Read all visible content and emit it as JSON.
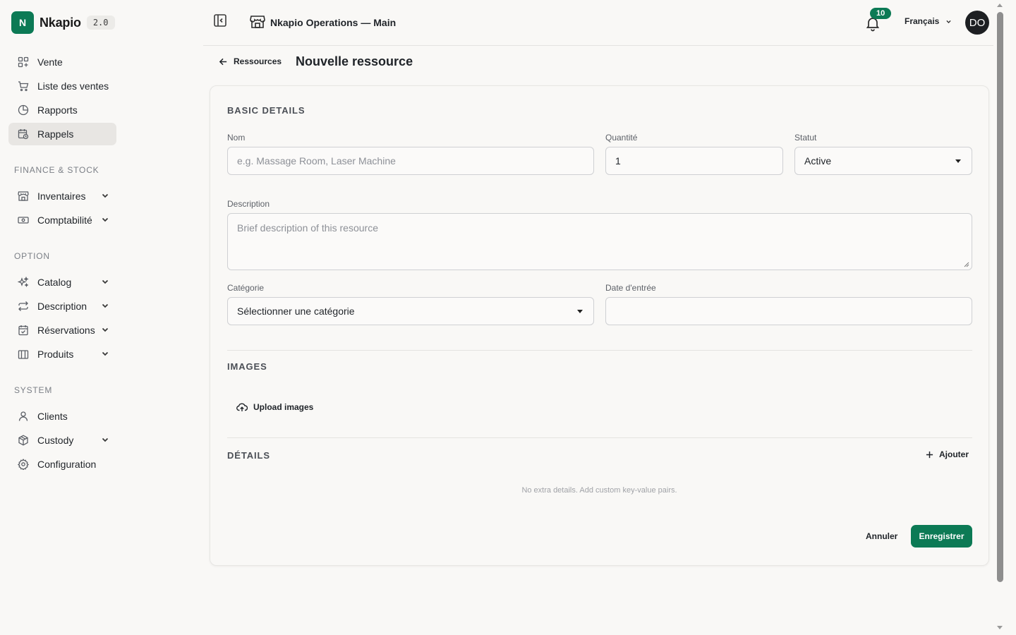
{
  "brand": {
    "logo_letter": "N",
    "name": "Nkapio",
    "version": "2.0"
  },
  "sidebar": {
    "main_items": [
      {
        "label": "Vente",
        "icon": "layout-grid-plus-icon"
      },
      {
        "label": "Liste des ventes",
        "icon": "shopping-cart-icon"
      },
      {
        "label": "Rapports",
        "icon": "pie-chart-icon"
      },
      {
        "label": "Rappels",
        "icon": "calendar-clock-icon",
        "active": true
      }
    ],
    "sections": [
      {
        "title": "FINANCE & STOCK",
        "items": [
          {
            "label": "Inventaires",
            "icon": "store-icon",
            "expandable": true
          },
          {
            "label": "Comptabilité",
            "icon": "banknote-icon",
            "expandable": true
          }
        ]
      },
      {
        "title": "OPTION",
        "items": [
          {
            "label": "Catalog",
            "icon": "sparkles-icon",
            "expandable": true
          },
          {
            "label": "Description",
            "icon": "repeat-icon",
            "expandable": true
          },
          {
            "label": "Réservations",
            "icon": "calendar-check-icon",
            "expandable": true
          },
          {
            "label": "Produits",
            "icon": "package-icon",
            "expandable": true
          }
        ]
      },
      {
        "title": "SYSTEM",
        "items": [
          {
            "label": "Clients",
            "icon": "user-icon",
            "expandable": false
          },
          {
            "label": "Custody",
            "icon": "box-icon",
            "expandable": true
          },
          {
            "label": "Configuration",
            "icon": "gear-icon",
            "expandable": false
          }
        ]
      }
    ]
  },
  "topbar": {
    "store_name": "Nkapio Operations — Main",
    "notifications_count": "10",
    "language": "Français",
    "avatar_initials": "DO"
  },
  "page": {
    "back_label": "Ressources",
    "title": "Nouvelle ressource"
  },
  "form": {
    "basic_details_title": "BASIC DETAILS",
    "name_label": "Nom",
    "name_placeholder": "e.g. Massage Room, Laser Machine",
    "quantity_label": "Quantité",
    "quantity_value": "1",
    "status_label": "Statut",
    "status_value": "Active",
    "description_label": "Description",
    "description_placeholder": "Brief description of this resource",
    "category_label": "Catégorie",
    "category_value": "Sélectionner une catégorie",
    "entry_date_label": "Date d'entrée",
    "entry_date_value": "",
    "images_title": "IMAGES",
    "upload_label": "Upload images",
    "details_title": "DÉTAILS",
    "add_label": "Ajouter",
    "details_empty": "No extra details. Add custom key-value pairs.",
    "cancel_label": "Annuler",
    "save_label": "Enregistrer"
  },
  "colors": {
    "accent": "#0c7a55",
    "background": "#f9f8f6",
    "active_nav": "#e8e6e3"
  }
}
